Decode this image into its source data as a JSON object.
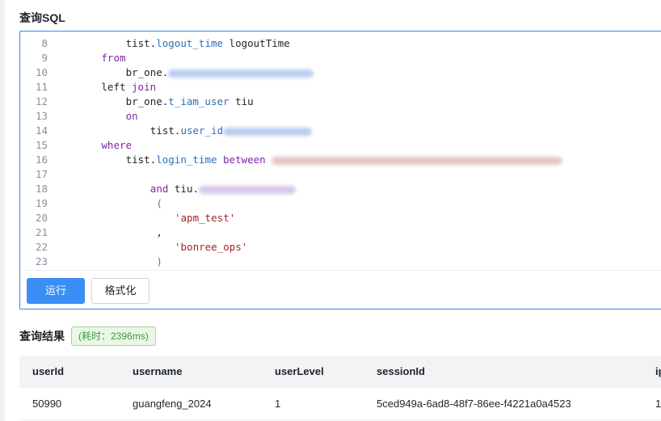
{
  "page": {
    "sql_section_title": "查询SQL",
    "result_section_title": "查询结果",
    "elapsed_badge": "(耗时：2396ms)"
  },
  "toolbar": {
    "run_label": "运行",
    "format_label": "格式化"
  },
  "code": {
    "lines": [
      {
        "num": "8",
        "parts": [
          {
            "t": "plain",
            "v": "tist."
          },
          {
            "t": "fn",
            "v": "logout_time"
          },
          {
            "t": "plain",
            "v": " logoutTime"
          }
        ]
      },
      {
        "num": "9",
        "parts": [
          {
            "t": "kw",
            "v": "from"
          }
        ]
      },
      {
        "num": "10",
        "parts": [
          {
            "t": "plain",
            "v": "br_one."
          },
          {
            "t": "blur",
            "c": "blue",
            "w": 180
          }
        ]
      },
      {
        "num": "11",
        "parts": [
          {
            "t": "plain",
            "v": "left "
          },
          {
            "t": "kw",
            "v": "join"
          }
        ]
      },
      {
        "num": "12",
        "parts": [
          {
            "t": "plain",
            "v": "br_one."
          },
          {
            "t": "fn",
            "v": "t_iam_user"
          },
          {
            "t": "plain",
            "v": " tiu"
          }
        ]
      },
      {
        "num": "13",
        "parts": [
          {
            "t": "kw",
            "v": "on"
          }
        ]
      },
      {
        "num": "14",
        "parts": [
          {
            "t": "plain",
            "v": "tist."
          },
          {
            "t": "fn",
            "v": "user_id"
          },
          {
            "t": "blur",
            "c": "blue",
            "w": 110
          }
        ]
      },
      {
        "num": "15",
        "parts": [
          {
            "t": "kw",
            "v": "where"
          }
        ]
      },
      {
        "num": "16",
        "parts": [
          {
            "t": "plain",
            "v": "tist."
          },
          {
            "t": "fn",
            "v": "login_time"
          },
          {
            "t": "plain",
            "v": " "
          },
          {
            "t": "kw",
            "v": "between"
          },
          {
            "t": "plain",
            "v": " "
          },
          {
            "t": "blur",
            "c": "pink",
            "w": 360
          }
        ]
      },
      {
        "num": "17",
        "parts": []
      },
      {
        "num": "18",
        "parts": [
          {
            "t": "kw",
            "v": "and"
          },
          {
            "t": "plain",
            "v": " tiu."
          },
          {
            "t": "blur",
            "c": "purple",
            "w": 120
          }
        ]
      },
      {
        "num": "19",
        "parts": [
          {
            "t": "punct",
            "v": "("
          }
        ]
      },
      {
        "num": "20",
        "parts": [
          {
            "t": "str",
            "v": "'apm_test'"
          }
        ]
      },
      {
        "num": "21",
        "parts": [
          {
            "t": "plain",
            "v": ","
          }
        ]
      },
      {
        "num": "22",
        "parts": [
          {
            "t": "str",
            "v": "'bonree_ops'"
          }
        ]
      },
      {
        "num": "23",
        "parts": [
          {
            "t": "punct",
            "v": ")"
          }
        ]
      }
    ],
    "indents": [
      12,
      8,
      12,
      8,
      12,
      12,
      16,
      8,
      12,
      0,
      16,
      17,
      20,
      17,
      20,
      17
    ]
  },
  "table": {
    "columns": [
      "userId",
      "username",
      "userLevel",
      "sessionId",
      "ip"
    ],
    "rows": [
      [
        "50990",
        "guangfeng_2024",
        "1",
        "5ced949a-6ad8-48f7-86ee-f4221a0a4523",
        "1"
      ]
    ]
  },
  "colors": {
    "accent": "#3b8df7",
    "editor_border": "#3b82f6",
    "keyword": "#7c26a8",
    "identifier": "#2c6fbb",
    "string": "#a3262b",
    "success_badge": "#3a9a3a"
  }
}
